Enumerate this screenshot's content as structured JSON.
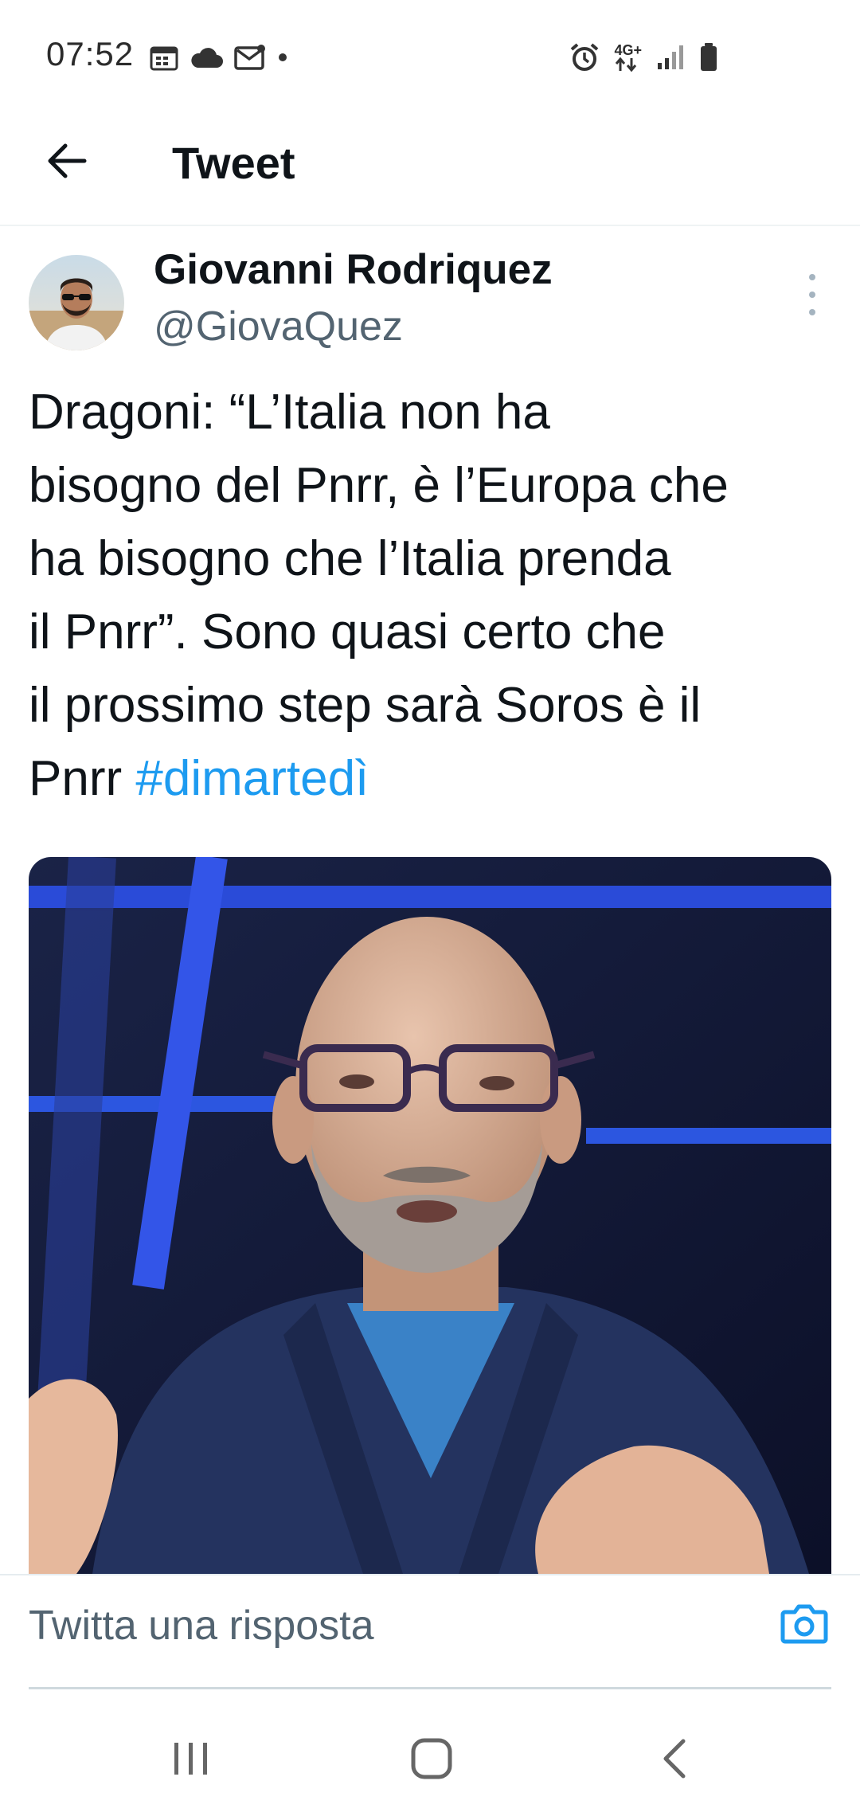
{
  "status_bar": {
    "time": "07:52",
    "left_icons": [
      "calendar-icon",
      "cloud-icon",
      "mail-icon",
      "dot-icon"
    ],
    "right_icons": [
      "alarm-icon",
      "network-4g-icon",
      "signal-icon",
      "battery-icon"
    ],
    "network_label": "4G+"
  },
  "header": {
    "title": "Tweet",
    "back_icon": "arrow-left-icon"
  },
  "tweet": {
    "author_name": "Giovanni Rodriquez",
    "author_handle": "@GiovaQuez",
    "text_lines": [
      "Dragoni: “L’Italia non ha",
      "bisogno del Pnrr, è l’Europa che",
      "ha bisogno che l’Italia prenda",
      "il Pnrr”. Sono quasi certo che",
      "il prossimo step sarà Soros è il",
      "Pnrr "
    ],
    "hashtag": "#dimartedì"
  },
  "reply": {
    "placeholder": "Twitta una risposta",
    "camera_icon": "camera-icon"
  },
  "nav": {
    "icons": [
      "recent-apps-icon",
      "home-icon",
      "back-icon"
    ]
  },
  "colors": {
    "accent": "#1d9bf0",
    "text": "#0f1419",
    "secondary_text": "#536471"
  }
}
